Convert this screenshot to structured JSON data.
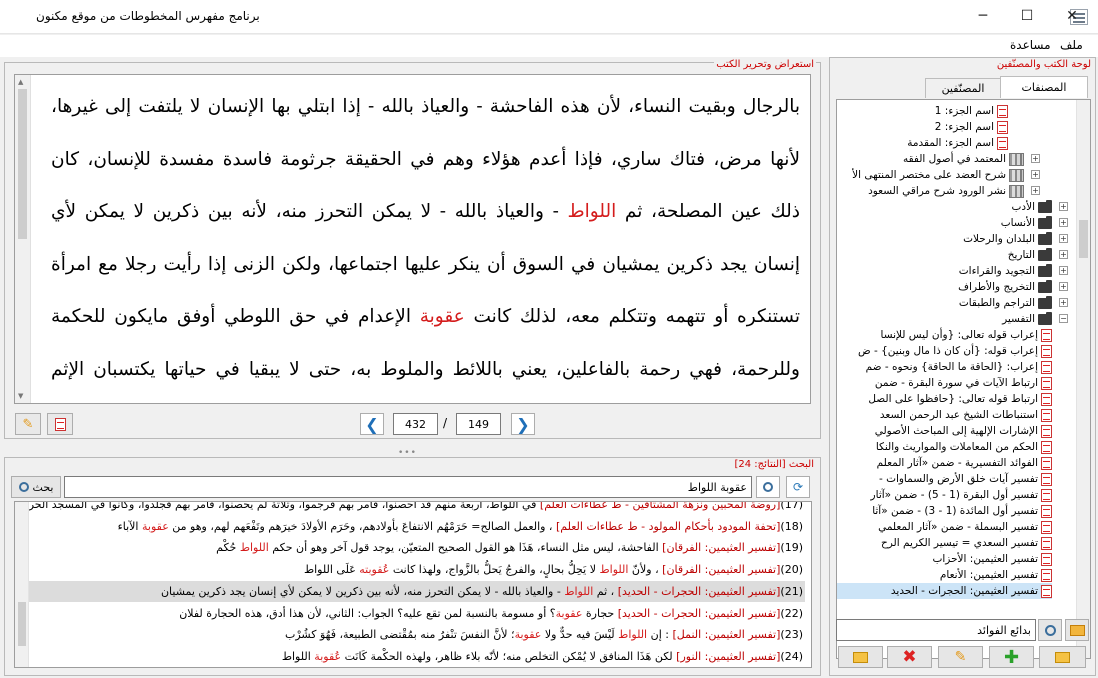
{
  "window": {
    "title": "برنامج مفهرس المخطوطات من موقع مكنون",
    "minimize": "─",
    "maximize": "☐",
    "close": "✕"
  },
  "menu": [
    {
      "label": "ملف"
    },
    {
      "label": "مساعدة"
    }
  ],
  "right_panel": {
    "caption": "لوحة الكتب والمصنّفين",
    "tabs": [
      {
        "label": "المصنفات"
      },
      {
        "label": "المصنّفين"
      }
    ],
    "tree": [
      {
        "label": "اسم الجزء: 1",
        "icon": "pdf",
        "level": 4
      },
      {
        "label": "اسم الجزء: 2",
        "icon": "pdf",
        "level": 4
      },
      {
        "label": "اسم الجزء: المقدمة",
        "icon": "pdf",
        "level": 4
      },
      {
        "label": "المعتمد في أصول الفقه",
        "icon": "book",
        "level": 3
      },
      {
        "label": "شرح العضد على مختصر المنتهى الأ",
        "icon": "book",
        "level": 3
      },
      {
        "label": "نشر الورود شرح مراقي السعود",
        "icon": "book",
        "level": 3
      },
      {
        "label": "الأدب",
        "icon": "folder",
        "level": 1
      },
      {
        "label": "الأنساب",
        "icon": "folder",
        "level": 1
      },
      {
        "label": "البلدان والرحلات",
        "icon": "folder",
        "level": 1
      },
      {
        "label": "التاريخ",
        "icon": "folder",
        "level": 1
      },
      {
        "label": "التجويد والقراءات",
        "icon": "folder",
        "level": 1
      },
      {
        "label": "التخريج والأطراف",
        "icon": "folder",
        "level": 1
      },
      {
        "label": "التراجم والطبقات",
        "icon": "folder",
        "level": 1
      },
      {
        "label": "التفسير",
        "icon": "folder",
        "level": 1,
        "expanded": true
      },
      {
        "label": "إعراب قوله تعالى: {وأن ليس للإنسا",
        "icon": "pdf",
        "level": 2
      },
      {
        "label": "إعراب قوله: {أن كان ذا مال وبنين} - ض",
        "icon": "pdf",
        "level": 2
      },
      {
        "label": "إعراب: {الحاقة ما الحاقة} ونحوه - ضم",
        "icon": "pdf",
        "level": 2
      },
      {
        "label": "ارتباط الآيات في سورة البقرة - ضمن",
        "icon": "pdf",
        "level": 2
      },
      {
        "label": "ارتباط قوله تعالى: {حافظوا على الصل",
        "icon": "pdf",
        "level": 2
      },
      {
        "label": "استنباطات الشيخ عبد الرحمن السعد",
        "icon": "pdf",
        "level": 2
      },
      {
        "label": "الإشارات الإلهية إلى المباحث الأصولي",
        "icon": "pdf",
        "level": 2
      },
      {
        "label": "الحكم من المعاملات والمواريث والنكا",
        "icon": "pdf",
        "level": 2
      },
      {
        "label": "الفوائد التفسيرية - ضمن «آثار المعلم",
        "icon": "pdf",
        "level": 2
      },
      {
        "label": "تفسير آيات خلق الأرض والسماوات -",
        "icon": "pdf",
        "level": 2
      },
      {
        "label": "تفسير أول البقرة (1 - 5) - ضمن «آثار",
        "icon": "pdf",
        "level": 2
      },
      {
        "label": "تفسير أول المائدة (1 - 3) - ضمن «آثا",
        "icon": "pdf",
        "level": 2
      },
      {
        "label": "تفسير البسملة - ضمن «آثار المعلمي",
        "icon": "pdf",
        "level": 2
      },
      {
        "label": "تفسير السعدي = تيسير الكريم الرح",
        "icon": "pdf",
        "level": 2
      },
      {
        "label": "تفسير العثيمين: الأحزاب",
        "icon": "pdf",
        "level": 2
      },
      {
        "label": "تفسير العثيمين: الأنعام",
        "icon": "pdf",
        "level": 2
      },
      {
        "label": "تفسير العثيمين: الحجرات - الحديد",
        "icon": "pdf",
        "level": 2,
        "selected": true
      }
    ],
    "search_value": "بدائع الفوائد",
    "buttons": [
      "open-folder",
      "add",
      "edit",
      "delete",
      "new-folder"
    ]
  },
  "viewer": {
    "caption": "استعراض وتحرير الكتب",
    "text": [
      {
        "t": "بالرجال وبقيت النساء، لأن هذه الفاحشة - والعياذ بالله - إذا ابتلي بها الإنسان لا يلتفت إلى غيرها، لأنها مرض، فتاك ساري، فإذا أعدم هؤلاء وهم في الحقيقة جرثومة فاسدة مفسدة للإنسان، كان ذلك عين المصلحة، ثم "
      },
      {
        "t": "اللواط",
        "hl": true
      },
      {
        "t": " - والعياذ بالله - لا يمكن التحرز منه، لأنه بين ذكرين لا يمكن لأي إنسان يجد ذكرين يمشيان في السوق أن ينكر عليها اجتماعها، ولكن الزنى إذا رأيت رجلا مع امرأة تستنكره أو تتهمه وتتكلم معه، لذلك كانت "
      },
      {
        "t": "عقوبة",
        "hl": true
      },
      {
        "t": " الإعدام في حق اللوطي أوفق مايكون للحكمة وللرحمة، فهي رحمة بالفاعلين، يعني باللائط والملوط به، حتى لا يبقيا في حياتها يكتسبان الإثم وتزداد العقوبة عليها، ورحمة بالمجتمع لئلا تنتشر فيه هذه الفاحشة."
      }
    ],
    "page_current": "149",
    "page_separator": "/",
    "page_total": "432"
  },
  "search": {
    "caption": "البحث [النتائج: 24]",
    "query": "عقوبة اللواط",
    "search_button": "بحث",
    "results": [
      {
        "n": "(17)",
        "book": "[روضة المحبين ونزهة المشتاقين - ط عطاءات العلم]",
        "text": " في اللواط، أربعة منهم قد أحصنوا، فأمر بهم فرجموا، وثلاثة لم يحصنوا، فأمر بهم فجلدوا، وكانوا في المسجد الحرام، فرجموا",
        "hl": []
      },
      {
        "n": "(18)",
        "book": "[تحفة المودود بأحكام المولود - ط عطاءات العلم]",
        "text": " ، والعمل الصالح= حَرَمْهُم الانتفاعَ بأولادهم، وحَرَم الأولادَ خيرَهم وتَفْعَهم لهم، وهو من ",
        "hl": [
          "عقوبة"
        ],
        "tail": " الآباء"
      },
      {
        "n": "(19)",
        "book": "[تفسير العثيمين: الفرقان]",
        "text": " الفاحشة، ليس مثل النساء، هَذَا هو القول الصحيح المتعيّن، يوجد قول آخر وهو أن حكم ",
        "hl": [
          "اللواط"
        ],
        "tail": " حُكْم"
      },
      {
        "n": "(20)",
        "book": "[تفسير العثيمين: الفرقان]",
        "text": " ، ولأنّ ",
        "hl": [
          "اللواط"
        ],
        "tail": " لا يَحِلُّ بحالٍ، والفرجُ يَحلُّ بالزَّواج، ولهذا كانت ",
        "hl2": "عُقوبته",
        "tail2": " عَلَى اللواط"
      },
      {
        "n": "(21)",
        "book": "[تفسير العثيمين: الحجرات - الحديد]",
        "text": " ، ثم ",
        "hl": [
          "اللواط"
        ],
        "tail": " - والعياذ بالله - لا يمكن التحرز منه، لأنه بين ذكرين لا يمكن لأي إنسان يجد ذكرين يمشيان",
        "selected": true
      },
      {
        "n": "(22)",
        "book": "[تفسير العثيمين: الحجرات - الحديد]",
        "text": " حجارة ",
        "hl": [
          "عقوبة"
        ],
        "tail": "؟ أو مسومة بالنسبة لمن تقع عليه؟ الجواب: الثاني، لأن هذا أدق، هذه الحجارة لفلان"
      },
      {
        "n": "(23)",
        "book": "[تفسير العثيمين: النمل]",
        "text": " : إن ",
        "hl": [
          "اللواط"
        ],
        "tail": " لَيْسَ فيه حدٌّ ولا ",
        "hl2": "عقوبة",
        "tail2": "؛ لأنَّ النفسَ تنْفرُ منه بمُقْتضى الطبيعة، فَهُوَ كشُرْب"
      },
      {
        "n": "(24)",
        "book": "[تفسير العثيمين: النور]",
        "text": " لكن هَذَا المنافق لا يُمْكن التخلص منه؛ لأنّه بلاء ظاهر، ولهذه الحكْمة كَانَت ",
        "hl": [
          "عُقوبة"
        ],
        "tail": " اللواط"
      }
    ]
  },
  "colors": {
    "highlight": "#d41c1c",
    "caption": "#cc0000",
    "nav_arrow": "#1f6fb8"
  }
}
